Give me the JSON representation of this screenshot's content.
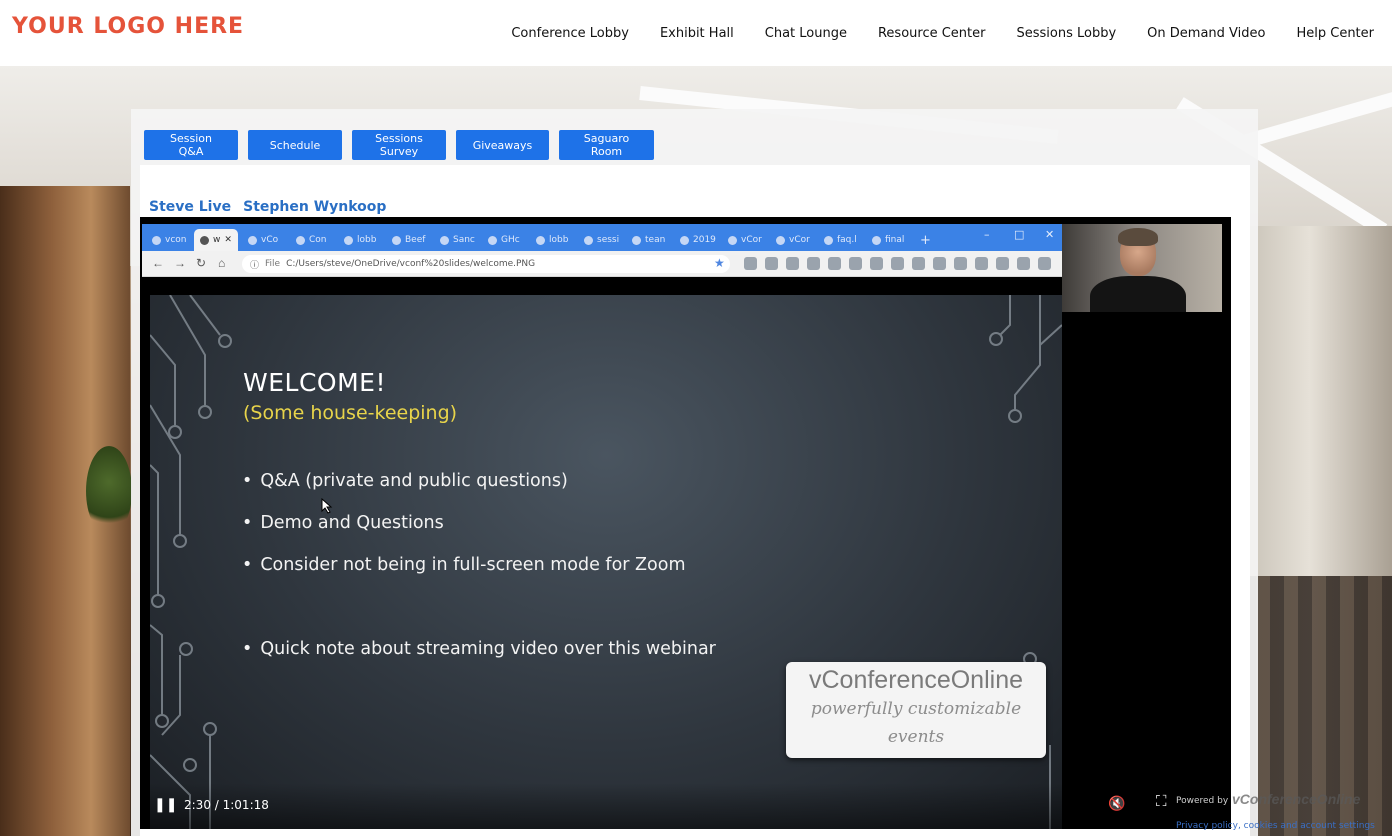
{
  "header": {
    "logo_text": "YOUR LOGO HERE",
    "nav": [
      "Conference Lobby",
      "Exhibit Hall",
      "Chat Lounge",
      "Resource Center",
      "Sessions Lobby",
      "On Demand Video",
      "Help Center"
    ]
  },
  "tabs": [
    "Session Q&A",
    "Schedule",
    "Sessions Survey",
    "Giveaways",
    "Saguaro Room"
  ],
  "session": {
    "title": "Steve Live",
    "presenter": "Stephen Wynkoop"
  },
  "browser": {
    "tabs": [
      "vcon",
      "w",
      "vCo",
      "Con",
      "lobb",
      "Beef",
      "Sanc",
      "GHc",
      "lobb",
      "sessi",
      "tean",
      "2019",
      "vCor",
      "vCor",
      "faq.l",
      "final"
    ],
    "new_tab": "+",
    "address_label": "File",
    "url": "C:/Users/steve/OneDrive/vconf%20slides/welcome.PNG"
  },
  "slide": {
    "title": "WELCOME!",
    "subtitle": "(Some house-keeping)",
    "bullets": [
      "Q&A (private and public questions)",
      "Demo and Questions",
      "Consider not being in full-screen mode for Zoom",
      "Quick note about streaming video over this webinar"
    ],
    "brand_logo": "vConferenceOnline",
    "brand_tagline": "powerfully customizable events"
  },
  "video": {
    "time": "2:30 / 1:01:18"
  },
  "footer": {
    "powered_by": "Powered by",
    "powered_brand": "vConferenceOnline",
    "privacy": "Privacy policy, cookies and account settings"
  },
  "colors": {
    "accent": "#1e72e8",
    "logo": "#e5533a",
    "presenter_link": "#2a6fc4",
    "slide_subtitle": "#e8d44a"
  },
  "icons": [
    "play-pause-icon",
    "mute-icon",
    "fullscreen-icon",
    "back-icon",
    "forward-icon",
    "reload-icon",
    "home-icon",
    "star-icon"
  ]
}
